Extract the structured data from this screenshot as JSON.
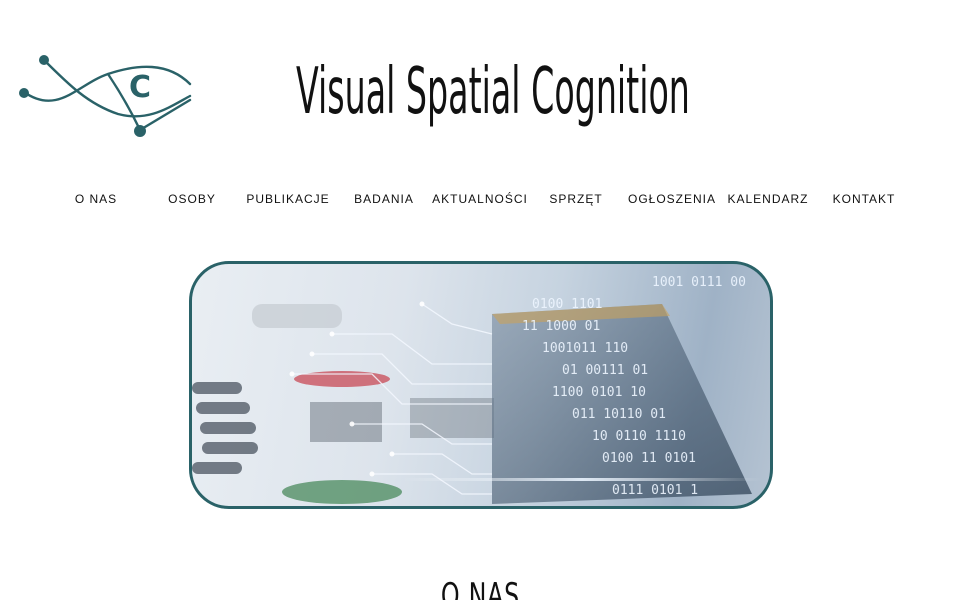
{
  "header": {
    "title": "Visual Spatial Cognition",
    "logo": {
      "icon": "eye-logo-icon",
      "letter": "C",
      "color": "#2a6268"
    }
  },
  "nav": {
    "items": [
      {
        "label": "O NAS"
      },
      {
        "label": "OSOBY"
      },
      {
        "label": "PUBLIKACJE"
      },
      {
        "label": "BADANIA"
      },
      {
        "label": "AKTUALNOŚCI"
      },
      {
        "label": "SPRZĘT"
      },
      {
        "label": "OGŁOSZENIA"
      },
      {
        "label": "KALENDARZ"
      },
      {
        "label": "KONTAKT"
      }
    ]
  },
  "hero": {
    "image": "circuit-board-binary-image",
    "border_color": "#2a6268",
    "binary_lines": [
      "0100 1101",
      "11 1000 01",
      "1001011 110",
      "01 00111 01",
      "1100 0101 10",
      "011 10110 01",
      "10 0110 1110",
      "0100 11 0101",
      "1001 0111 00",
      "0111 0101 1"
    ]
  },
  "section": {
    "heading": "O NAS"
  }
}
